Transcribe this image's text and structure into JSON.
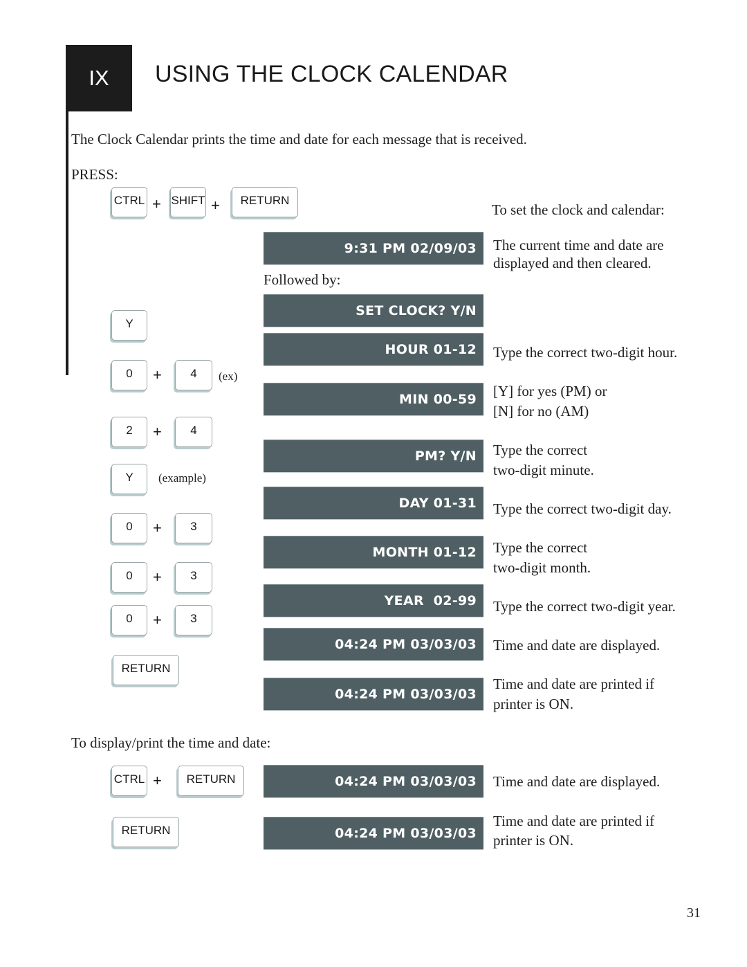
{
  "chapter": {
    "number": "IX",
    "title": "USING THE CLOCK CALENDAR"
  },
  "intro": "The Clock Calendar prints the time and date for each message that is received.",
  "press_label": "PRESS:",
  "set_section": {
    "heading": "To set the clock and calendar:",
    "followed_by": "Followed by:",
    "start_keys": [
      "CTRL",
      "SHIFT",
      "RETURN"
    ],
    "plus": "+",
    "steps": [
      {
        "keys": [],
        "display": "9:31 PM 02/09/03",
        "note": "The current time and date are\ndisplayed and then cleared.",
        "note_lines": [
          "The current time and date are",
          "displayed and then cleared."
        ]
      },
      {
        "keys": [],
        "display": "SET CLOCK? Y/N",
        "note_lines": []
      },
      {
        "keys": [
          "Y"
        ],
        "display": "HOUR 01-12",
        "note_lines": [
          "Type the correct two-digit hour."
        ]
      },
      {
        "keys": [
          "0",
          "4"
        ],
        "annotation": "(ex)",
        "display": "MIN 00-59",
        "note_lines": [
          "[Y] for yes (PM) or",
          "[N] for no (AM)"
        ]
      },
      {
        "keys": [
          "2",
          "4"
        ],
        "display": "PM? Y/N",
        "note_lines": [
          "Type the correct",
          "two-digit minute."
        ]
      },
      {
        "keys": [
          "Y"
        ],
        "annotation": "(example)",
        "display": "DAY 01-31",
        "note_lines": [
          "Type the correct two-digit day."
        ]
      },
      {
        "keys": [
          "0",
          "3"
        ],
        "display": "MONTH 01-12",
        "note_lines": [
          "Type the correct",
          "two-digit month."
        ]
      },
      {
        "keys": [
          "0",
          "3"
        ],
        "display": "YEAR  02-99",
        "note_lines": [
          "Type the correct two-digit year."
        ]
      },
      {
        "keys": [
          "0",
          "3"
        ],
        "display": "04:24 PM 03/03/03",
        "note_lines": [
          "Time and date are displayed."
        ]
      },
      {
        "keys": [
          "RETURN"
        ],
        "display": "04:24 PM 03/03/03",
        "note_lines": [
          "Time and date are printed if",
          "printer is ON."
        ]
      }
    ]
  },
  "display_section": {
    "heading": "To display/print the time and date:",
    "rows": [
      {
        "keys": [
          "CTRL",
          "RETURN"
        ],
        "display": "04:24 PM 03/03/03",
        "note_lines": [
          "Time and date are displayed."
        ]
      },
      {
        "keys": [
          "RETURN"
        ],
        "display": "04:24 PM 03/03/03",
        "note_lines": [
          "Time and date are printed if",
          "printer is ON."
        ]
      }
    ]
  },
  "page_number": "31",
  "colors": {
    "lcd_background": "#4f5f64",
    "lcd_text": "#ffffff",
    "chapter_box": "#1c1c1c",
    "key_shadow": "#b9cccd"
  }
}
